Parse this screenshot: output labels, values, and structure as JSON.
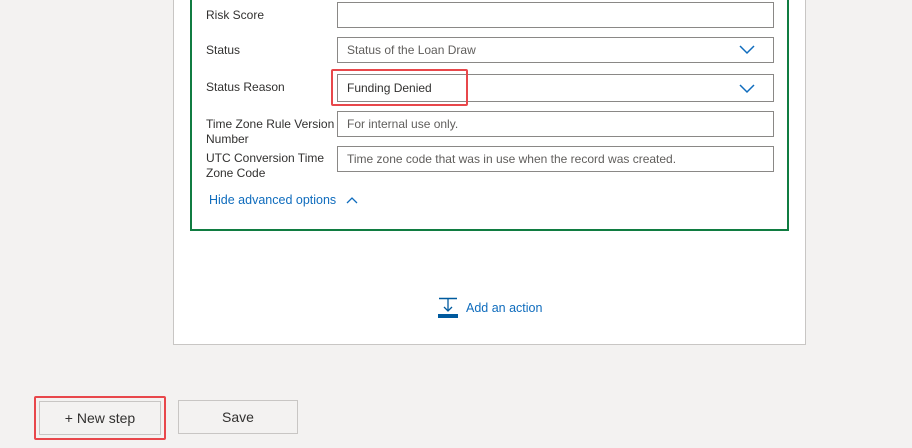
{
  "form": {
    "risk_score": {
      "label": "Risk Score",
      "value": ""
    },
    "status": {
      "label": "Status",
      "placeholder": "Status of the Loan Draw"
    },
    "status_reason": {
      "label": "Status Reason",
      "value": "Funding Denied"
    },
    "time_zone_rule": {
      "label_line1": "Time Zone Rule Version",
      "label_line2": "Number",
      "placeholder": "For internal use only."
    },
    "utc_conversion": {
      "label_line1": "UTC Conversion Time",
      "label_line2": "Zone Code",
      "placeholder": "Time zone code that was in use when the record was created."
    },
    "hide_advanced_label": "Hide advanced options"
  },
  "add_action_label": "Add an action",
  "footer": {
    "new_step_label": "+ New step",
    "save_label": "Save"
  },
  "colors": {
    "accent_link": "#0f6cbd",
    "card_border": "#107c41",
    "highlight": "#e8474b"
  }
}
